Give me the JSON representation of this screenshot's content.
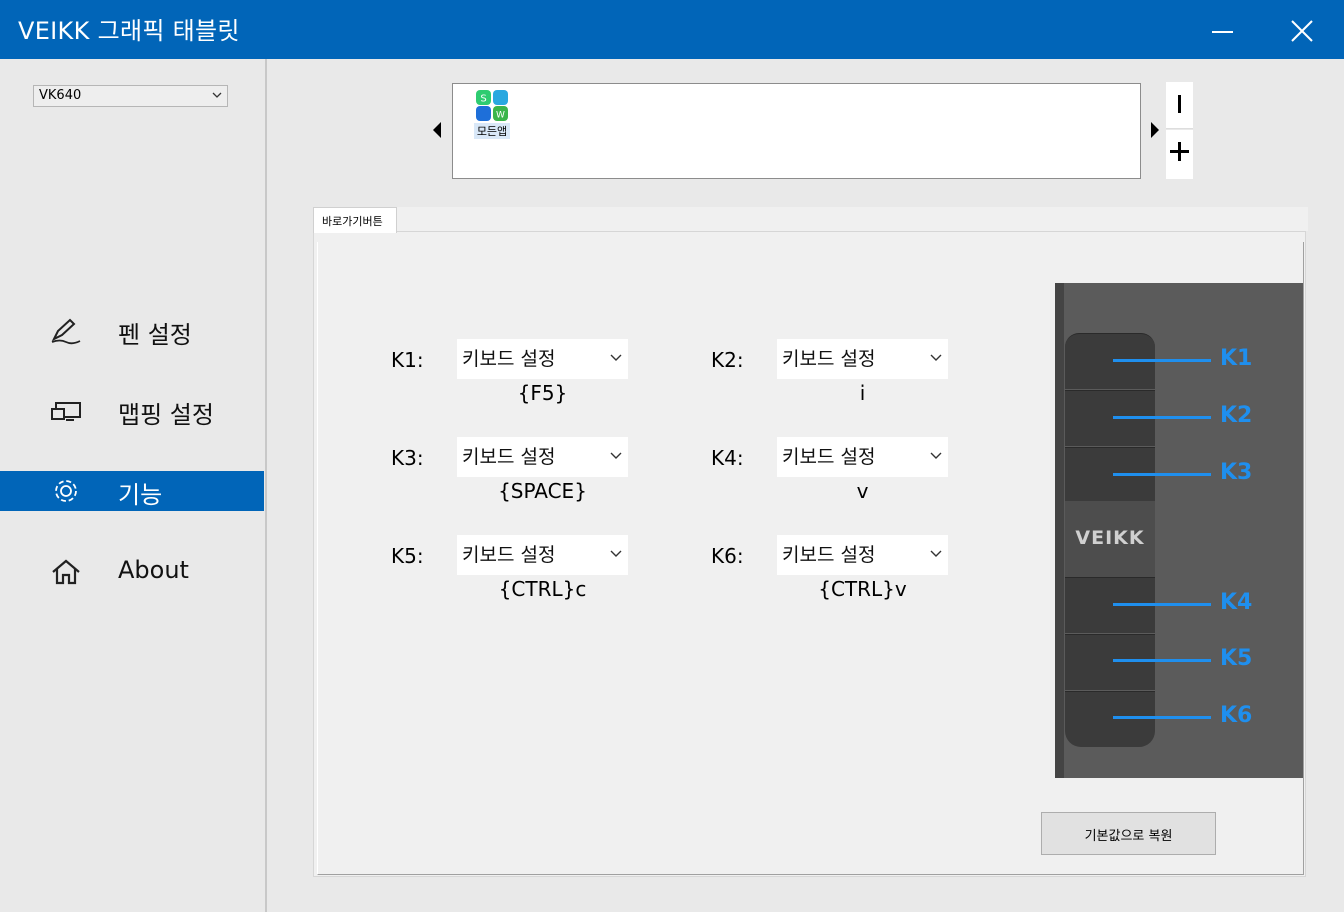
{
  "window": {
    "title": "VEIKK 그래픽 태블릿"
  },
  "sidebar": {
    "model": "VK640",
    "items": [
      {
        "label": "펜 설정",
        "icon": "pen-icon"
      },
      {
        "label": "맵핑 설정",
        "icon": "monitor-icon"
      },
      {
        "label": "기능",
        "icon": "gear-icon",
        "active": true
      },
      {
        "label": "About",
        "icon": "home-icon"
      }
    ]
  },
  "apps": {
    "items": [
      {
        "label": "모든앱",
        "icon": "all-apps-icon"
      }
    ]
  },
  "tabs": [
    {
      "label": "바로가기버튼"
    }
  ],
  "keys": [
    {
      "label": "K1:",
      "mode": "키보드 설정",
      "value": "{F5}"
    },
    {
      "label": "K2:",
      "mode": "키보드 설정",
      "value": "i"
    },
    {
      "label": "K3:",
      "mode": "키보드 설정",
      "value": "{SPACE}"
    },
    {
      "label": "K4:",
      "mode": "키보드 설정",
      "value": "v"
    },
    {
      "label": "K5:",
      "mode": "키보드 설정",
      "value": "{CTRL}c"
    },
    {
      "label": "K6:",
      "mode": "키보드 설정",
      "value": "{CTRL}v"
    }
  ],
  "tablet": {
    "logo": "VEIKK",
    "key_labels": [
      "K1",
      "K2",
      "K3",
      "K4",
      "K5",
      "K6"
    ],
    "accent_color": "#1f8fee"
  },
  "restore_button": "기본값으로 복원",
  "colors": {
    "titlebar": "#0165b8",
    "active_nav": "#0165b8"
  }
}
